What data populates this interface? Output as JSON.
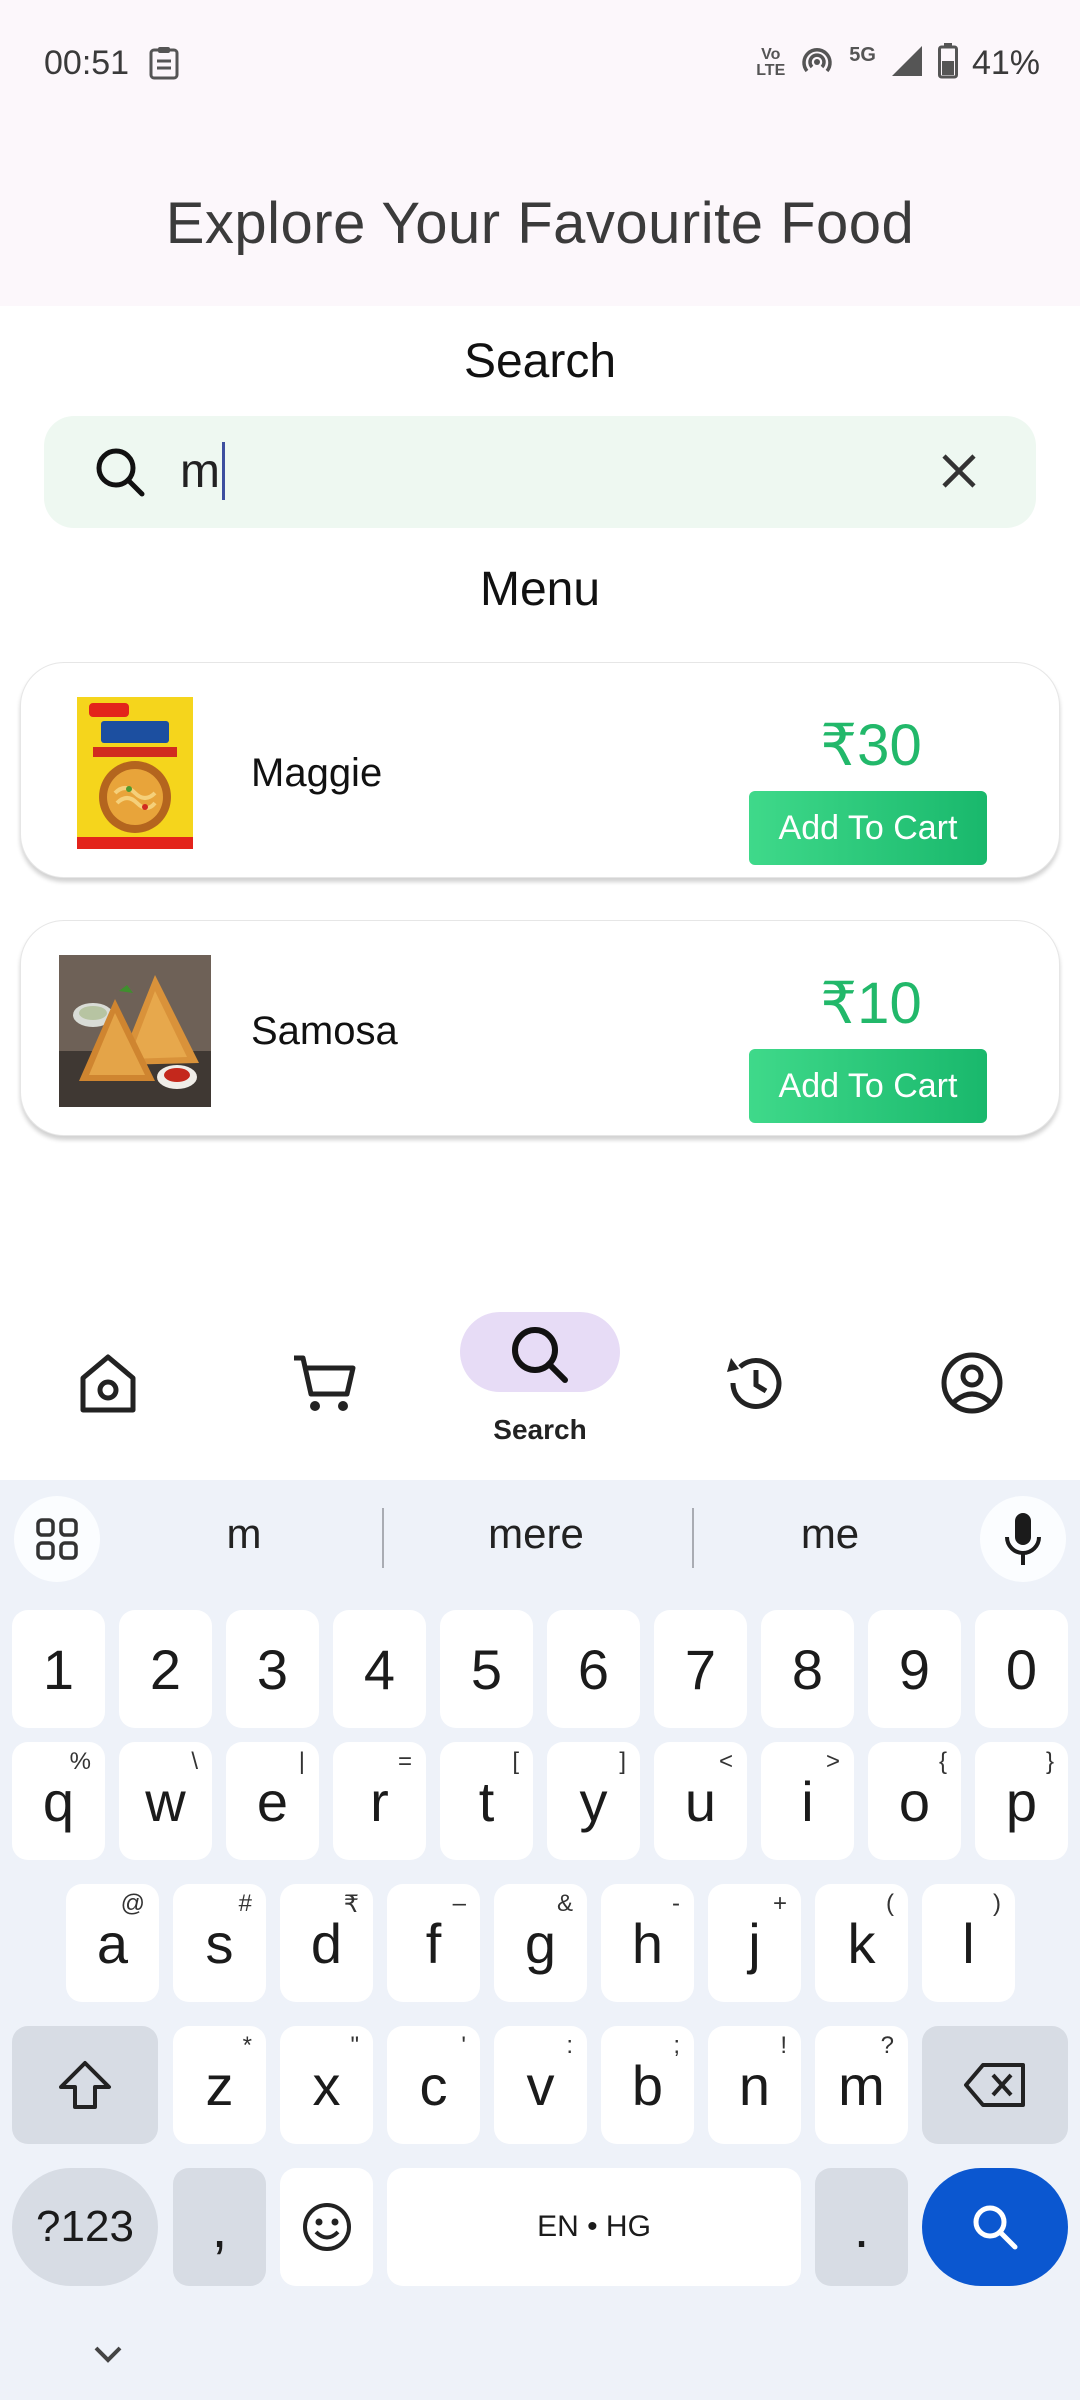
{
  "status_bar": {
    "time": "00:51",
    "network_label_top": "Vo",
    "network_label_bottom": "LTE",
    "network_type": "5G",
    "battery": "41%"
  },
  "header": {
    "title": "Explore Your Favourite Food"
  },
  "search_section": {
    "label": "Search",
    "input_value": "m"
  },
  "menu_section": {
    "label": "Menu",
    "items": [
      {
        "name": "Maggie",
        "price": "₹30",
        "button_label": "Add To Cart"
      },
      {
        "name": "Samosa",
        "price": "₹10",
        "button_label": "Add To Cart"
      }
    ]
  },
  "bottom_nav": {
    "active_label": "Search",
    "items": [
      "home-icon",
      "cart-icon",
      "search-icon",
      "history-icon",
      "profile-icon"
    ]
  },
  "keyboard": {
    "suggestions": [
      "m",
      "mere",
      "me"
    ],
    "number_row": [
      "1",
      "2",
      "3",
      "4",
      "5",
      "6",
      "7",
      "8",
      "9",
      "0"
    ],
    "row1": [
      {
        "k": "q",
        "h": "%"
      },
      {
        "k": "w",
        "h": "\\"
      },
      {
        "k": "e",
        "h": "|"
      },
      {
        "k": "r",
        "h": "="
      },
      {
        "k": "t",
        "h": "["
      },
      {
        "k": "y",
        "h": "]"
      },
      {
        "k": "u",
        "h": "<"
      },
      {
        "k": "i",
        "h": ">"
      },
      {
        "k": "o",
        "h": "{"
      },
      {
        "k": "p",
        "h": "}"
      }
    ],
    "row2": [
      {
        "k": "a",
        "h": "@"
      },
      {
        "k": "s",
        "h": "#"
      },
      {
        "k": "d",
        "h": "₹"
      },
      {
        "k": "f",
        "h": "–"
      },
      {
        "k": "g",
        "h": "&"
      },
      {
        "k": "h",
        "h": "-"
      },
      {
        "k": "j",
        "h": "+"
      },
      {
        "k": "k",
        "h": "("
      },
      {
        "k": "l",
        "h": ")"
      }
    ],
    "row3": [
      {
        "k": "z",
        "h": "*"
      },
      {
        "k": "x",
        "h": "\""
      },
      {
        "k": "c",
        "h": "'"
      },
      {
        "k": "v",
        "h": ":"
      },
      {
        "k": "b",
        "h": ";"
      },
      {
        "k": "n",
        "h": "!"
      },
      {
        "k": "m",
        "h": "?"
      }
    ],
    "symbols_key": "?123",
    "comma_key": ",",
    "space_label": "EN • HG",
    "period_key": ".",
    "accent_color": "#0b57d0"
  },
  "colors": {
    "price": "#22b86a",
    "button": "#19b86c",
    "search_bg": "#eef8f1",
    "nav_active_pill": "#e7dcf6"
  }
}
